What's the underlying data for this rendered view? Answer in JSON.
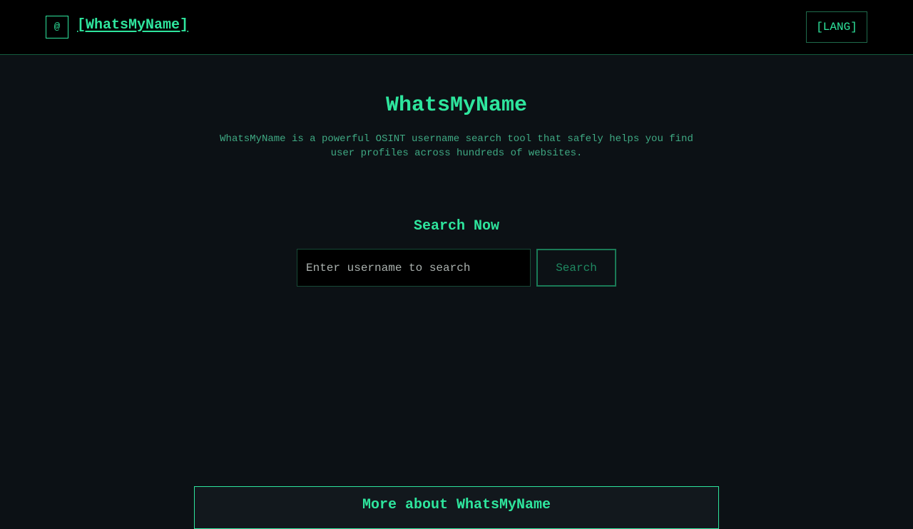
{
  "header": {
    "logo_glyph": "@",
    "brand": "[WhatsMyName]",
    "lang_button": "[LANG]"
  },
  "hero": {
    "title": "WhatsMyName",
    "description": "WhatsMyName is a powerful OSINT username search tool that safely helps you find user profiles across hundreds of websites."
  },
  "search": {
    "heading": "Search Now",
    "placeholder": "Enter username to search",
    "value": "",
    "button_label": "Search"
  },
  "more": {
    "title": "More about WhatsMyName"
  },
  "colors": {
    "accent": "#2ee59d",
    "background": "#0c1115",
    "header_background": "#000000"
  }
}
